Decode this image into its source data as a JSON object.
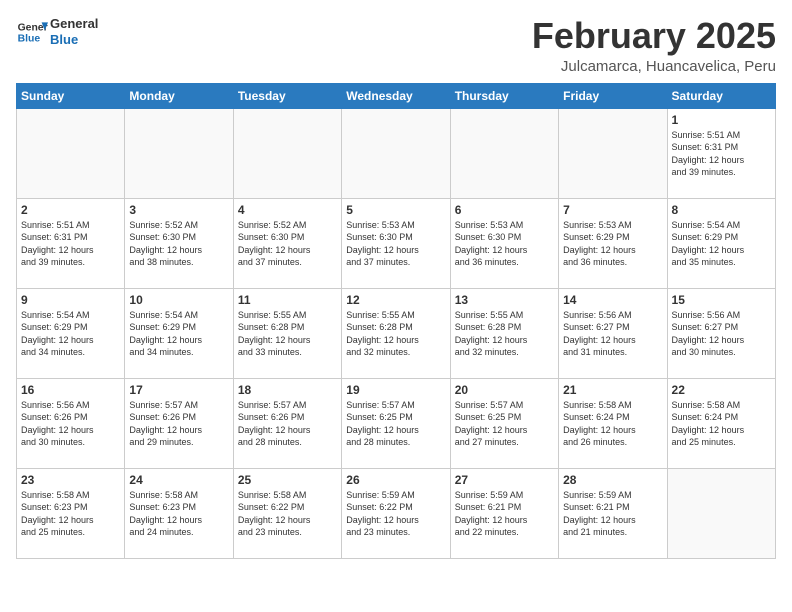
{
  "header": {
    "logo_line1": "General",
    "logo_line2": "Blue",
    "title": "February 2025",
    "subtitle": "Julcamarca, Huancavelica, Peru"
  },
  "days_of_week": [
    "Sunday",
    "Monday",
    "Tuesday",
    "Wednesday",
    "Thursday",
    "Friday",
    "Saturday"
  ],
  "weeks": [
    [
      {
        "day": "",
        "info": ""
      },
      {
        "day": "",
        "info": ""
      },
      {
        "day": "",
        "info": ""
      },
      {
        "day": "",
        "info": ""
      },
      {
        "day": "",
        "info": ""
      },
      {
        "day": "",
        "info": ""
      },
      {
        "day": "1",
        "info": "Sunrise: 5:51 AM\nSunset: 6:31 PM\nDaylight: 12 hours\nand 39 minutes."
      }
    ],
    [
      {
        "day": "2",
        "info": "Sunrise: 5:51 AM\nSunset: 6:31 PM\nDaylight: 12 hours\nand 39 minutes."
      },
      {
        "day": "3",
        "info": "Sunrise: 5:52 AM\nSunset: 6:30 PM\nDaylight: 12 hours\nand 38 minutes."
      },
      {
        "day": "4",
        "info": "Sunrise: 5:52 AM\nSunset: 6:30 PM\nDaylight: 12 hours\nand 37 minutes."
      },
      {
        "day": "5",
        "info": "Sunrise: 5:53 AM\nSunset: 6:30 PM\nDaylight: 12 hours\nand 37 minutes."
      },
      {
        "day": "6",
        "info": "Sunrise: 5:53 AM\nSunset: 6:30 PM\nDaylight: 12 hours\nand 36 minutes."
      },
      {
        "day": "7",
        "info": "Sunrise: 5:53 AM\nSunset: 6:29 PM\nDaylight: 12 hours\nand 36 minutes."
      },
      {
        "day": "8",
        "info": "Sunrise: 5:54 AM\nSunset: 6:29 PM\nDaylight: 12 hours\nand 35 minutes."
      }
    ],
    [
      {
        "day": "9",
        "info": "Sunrise: 5:54 AM\nSunset: 6:29 PM\nDaylight: 12 hours\nand 34 minutes."
      },
      {
        "day": "10",
        "info": "Sunrise: 5:54 AM\nSunset: 6:29 PM\nDaylight: 12 hours\nand 34 minutes."
      },
      {
        "day": "11",
        "info": "Sunrise: 5:55 AM\nSunset: 6:28 PM\nDaylight: 12 hours\nand 33 minutes."
      },
      {
        "day": "12",
        "info": "Sunrise: 5:55 AM\nSunset: 6:28 PM\nDaylight: 12 hours\nand 32 minutes."
      },
      {
        "day": "13",
        "info": "Sunrise: 5:55 AM\nSunset: 6:28 PM\nDaylight: 12 hours\nand 32 minutes."
      },
      {
        "day": "14",
        "info": "Sunrise: 5:56 AM\nSunset: 6:27 PM\nDaylight: 12 hours\nand 31 minutes."
      },
      {
        "day": "15",
        "info": "Sunrise: 5:56 AM\nSunset: 6:27 PM\nDaylight: 12 hours\nand 30 minutes."
      }
    ],
    [
      {
        "day": "16",
        "info": "Sunrise: 5:56 AM\nSunset: 6:26 PM\nDaylight: 12 hours\nand 30 minutes."
      },
      {
        "day": "17",
        "info": "Sunrise: 5:57 AM\nSunset: 6:26 PM\nDaylight: 12 hours\nand 29 minutes."
      },
      {
        "day": "18",
        "info": "Sunrise: 5:57 AM\nSunset: 6:26 PM\nDaylight: 12 hours\nand 28 minutes."
      },
      {
        "day": "19",
        "info": "Sunrise: 5:57 AM\nSunset: 6:25 PM\nDaylight: 12 hours\nand 28 minutes."
      },
      {
        "day": "20",
        "info": "Sunrise: 5:57 AM\nSunset: 6:25 PM\nDaylight: 12 hours\nand 27 minutes."
      },
      {
        "day": "21",
        "info": "Sunrise: 5:58 AM\nSunset: 6:24 PM\nDaylight: 12 hours\nand 26 minutes."
      },
      {
        "day": "22",
        "info": "Sunrise: 5:58 AM\nSunset: 6:24 PM\nDaylight: 12 hours\nand 25 minutes."
      }
    ],
    [
      {
        "day": "23",
        "info": "Sunrise: 5:58 AM\nSunset: 6:23 PM\nDaylight: 12 hours\nand 25 minutes."
      },
      {
        "day": "24",
        "info": "Sunrise: 5:58 AM\nSunset: 6:23 PM\nDaylight: 12 hours\nand 24 minutes."
      },
      {
        "day": "25",
        "info": "Sunrise: 5:58 AM\nSunset: 6:22 PM\nDaylight: 12 hours\nand 23 minutes."
      },
      {
        "day": "26",
        "info": "Sunrise: 5:59 AM\nSunset: 6:22 PM\nDaylight: 12 hours\nand 23 minutes."
      },
      {
        "day": "27",
        "info": "Sunrise: 5:59 AM\nSunset: 6:21 PM\nDaylight: 12 hours\nand 22 minutes."
      },
      {
        "day": "28",
        "info": "Sunrise: 5:59 AM\nSunset: 6:21 PM\nDaylight: 12 hours\nand 21 minutes."
      },
      {
        "day": "",
        "info": ""
      }
    ]
  ]
}
